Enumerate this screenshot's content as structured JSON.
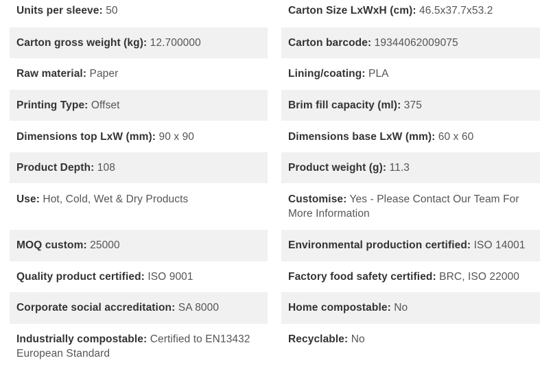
{
  "specs": {
    "left": [
      {
        "label": "Units per sleeve:",
        "value": "50"
      },
      {
        "label": "Carton gross weight (kg):",
        "value": "12.700000"
      },
      {
        "label": "Raw material:",
        "value": "Paper"
      },
      {
        "label": "Printing Type:",
        "value": "Offset"
      },
      {
        "label": "Dimensions top LxW (mm):",
        "value": "90 x 90"
      },
      {
        "label": "Product Depth:",
        "value": "108"
      },
      {
        "label": "Use:",
        "value": "Hot, Cold, Wet & Dry Products"
      },
      {
        "label": "MOQ custom:",
        "value": "25000"
      },
      {
        "label": "Quality product certified:",
        "value": "ISO 9001"
      },
      {
        "label": "Corporate social accreditation:",
        "value": "SA 8000"
      },
      {
        "label": "Industrially compostable:",
        "value": "Certified to EN13432 European Standard"
      }
    ],
    "right": [
      {
        "label": "Carton Size LxWxH (cm):",
        "value": "46.5x37.7x53.2"
      },
      {
        "label": "Carton barcode:",
        "value": "19344062009075"
      },
      {
        "label": "Lining/coating:",
        "value": "PLA"
      },
      {
        "label": "Brim fill capacity (ml):",
        "value": "375"
      },
      {
        "label": "Dimensions base LxW (mm):",
        "value": "60 x 60"
      },
      {
        "label": "Product weight (g):",
        "value": "11.3"
      },
      {
        "label": "Customise:",
        "value": "Yes - Please Contact Our Team For More Information"
      },
      {
        "label": "Environmental production certified:",
        "value": "ISO 14001"
      },
      {
        "label": "Factory food safety certified:",
        "value": "BRC, ISO 22000"
      },
      {
        "label": "Home compostable:",
        "value": "No"
      },
      {
        "label": "Recyclable:",
        "value": "No"
      }
    ]
  }
}
